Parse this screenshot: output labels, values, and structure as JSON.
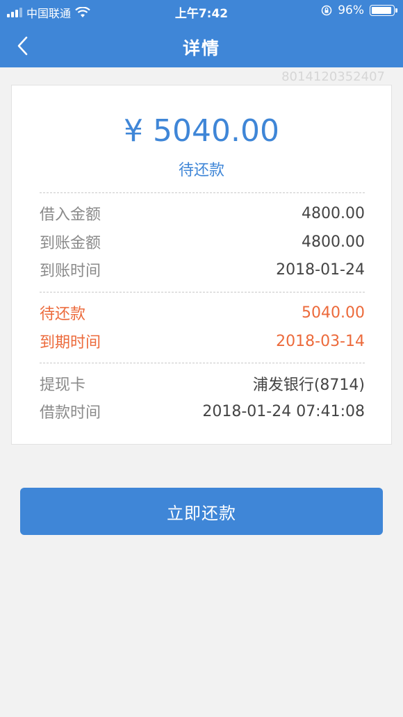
{
  "status_bar": {
    "carrier": "中国联通",
    "time": "上午7:42",
    "battery": "96%",
    "battery_level_percent": 96
  },
  "header": {
    "title": "详情",
    "back_icon": "chevron-left-icon"
  },
  "watermark_id": "8014120352407",
  "summary": {
    "amount": "¥ 5040.00",
    "status": "待还款"
  },
  "sections": [
    {
      "rows": [
        {
          "label": "借入金额",
          "value": "4800.00"
        },
        {
          "label": "到账金额",
          "value": "4800.00"
        },
        {
          "label": "到账时间",
          "value": "2018-01-24"
        }
      ]
    },
    {
      "rows": [
        {
          "label": "待还款",
          "value": "5040.00"
        },
        {
          "label": "到期时间",
          "value": "2018-03-14"
        }
      ]
    },
    {
      "rows": [
        {
          "label": "提现卡",
          "value": "浦发银行(8714)"
        },
        {
          "label": "借款时间",
          "value": "2018-01-24 07:41:08"
        }
      ]
    }
  ],
  "actions": {
    "repay_label": "立即还款"
  },
  "colors": {
    "brand_blue": "#3f86d7",
    "warning_orange": "#ec6a3b",
    "page_background": "#f2f2f2"
  }
}
